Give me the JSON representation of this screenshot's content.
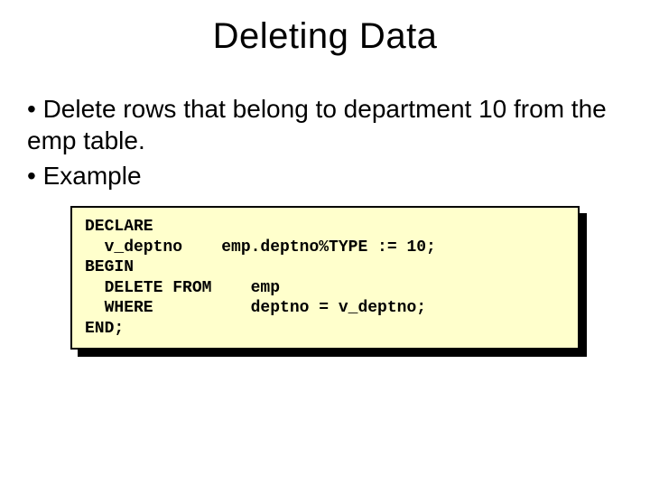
{
  "title": "Deleting Data",
  "bullets": [
    "• Delete rows that belong to department 10 from the emp table.",
    "• Example"
  ],
  "code": "DECLARE\n  v_deptno    emp.deptno%TYPE := 10;\nBEGIN\n  DELETE FROM    emp\n  WHERE          deptno = v_deptno;\nEND;"
}
